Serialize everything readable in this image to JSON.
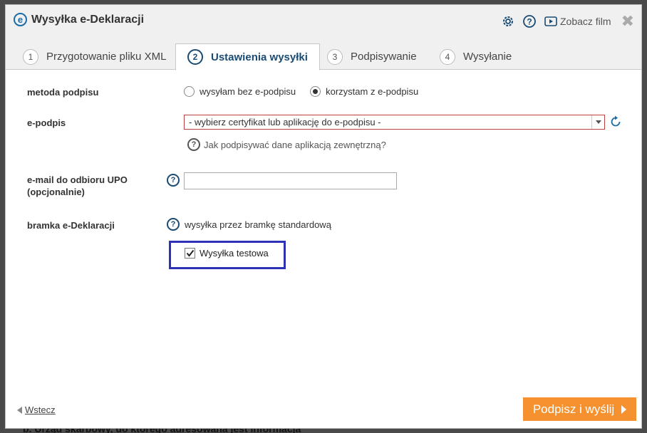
{
  "background": {
    "bottom_text": "b. Urząd skarbowy, do którego adresowana jest informacja"
  },
  "dialog": {
    "title": "Wysyłka e-Deklaracji",
    "logo_letter": "e",
    "film_label": "Zobacz film",
    "close_glyph": "✖"
  },
  "tabs": [
    {
      "num": "1",
      "label": "Przygotowanie pliku XML"
    },
    {
      "num": "2",
      "label": "Ustawienia wysyłki"
    },
    {
      "num": "3",
      "label": "Podpisywanie"
    },
    {
      "num": "4",
      "label": "Wysyłanie"
    }
  ],
  "form": {
    "metoda_label": "metoda podpisu",
    "radio_bez": "wysyłam bez e-podpisu",
    "radio_z": "korzystam z e-podpisu",
    "selected_method": "korzystam z e-podpisu",
    "epodpis_label": "e-podpis",
    "epodpis_select_value": "- wybierz certyfikat lub aplikację do e-podpisu -",
    "help_link": "Jak podpisywać dane aplikacją zewnętrzną?",
    "email_label_1": "e-mail do odbioru UPO",
    "email_label_2": "(opcjonalnie)",
    "email_value": "",
    "bramka_label": "bramka e-Deklaracji",
    "bramka_value": "wysyłka przez bramkę standardową",
    "test_checkbox_label": "Wysyłka testowa",
    "test_checked": true
  },
  "footer": {
    "back_label": "Wstecz",
    "submit_label": "Podpisz i wyślij"
  },
  "colors": {
    "accent_orange": "#f5922f",
    "accent_blue": "#1a4b74",
    "highlight_box": "#2d32b8"
  }
}
